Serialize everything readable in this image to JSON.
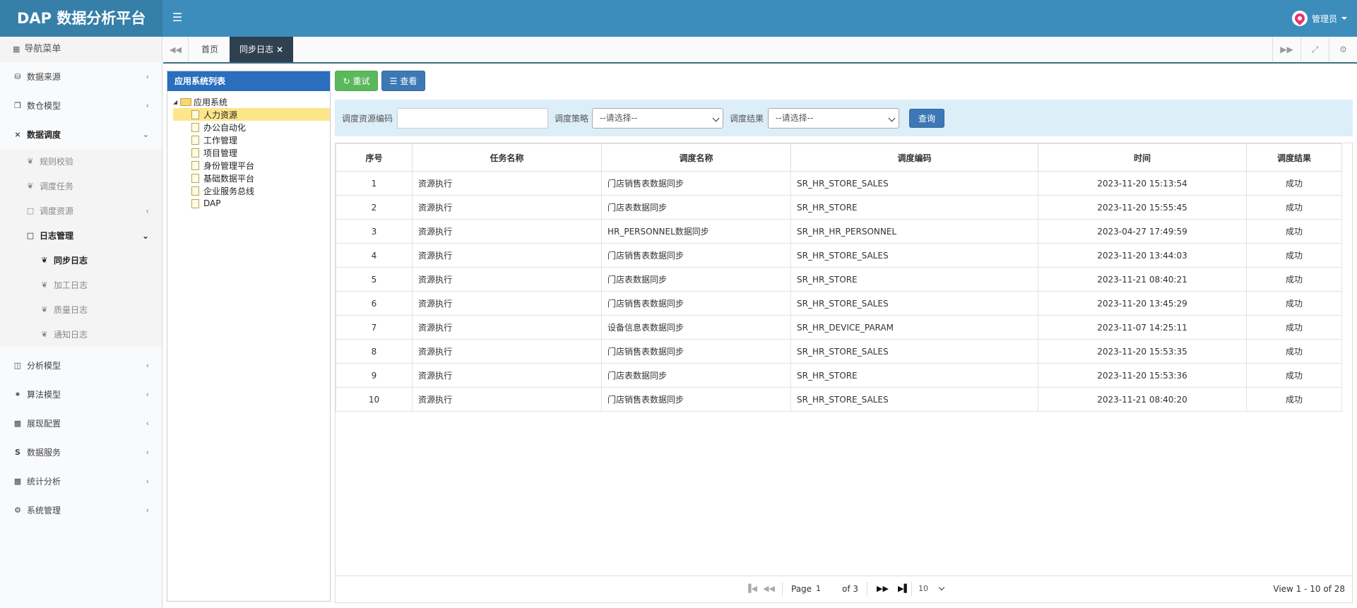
{
  "app": {
    "title": "DAP 数据分析平台"
  },
  "header": {
    "menu_icon": "hamburger-icon",
    "user_name": "管理员"
  },
  "sidebar": {
    "nav_header": "导航菜单",
    "items": [
      {
        "label": "数据来源",
        "icon": "database-icon"
      },
      {
        "label": "数仓模型",
        "icon": "cubes-icon"
      },
      {
        "label": "数据调度",
        "icon": "shuffle-icon",
        "expanded": true,
        "children": [
          {
            "label": "规则校验"
          },
          {
            "label": "调度任务"
          },
          {
            "label": "调度资源"
          },
          {
            "label": "日志管理",
            "expanded": true,
            "children": [
              {
                "label": "同步日志",
                "active": true
              },
              {
                "label": "加工日志"
              },
              {
                "label": "质量日志"
              },
              {
                "label": "通知日志"
              }
            ]
          }
        ]
      },
      {
        "label": "分析模型",
        "icon": "sitemap-icon"
      },
      {
        "label": "算法模型",
        "icon": "spinner-icon"
      },
      {
        "label": "展现配置",
        "icon": "film-icon"
      },
      {
        "label": "数据服务",
        "icon": "dollar-icon"
      },
      {
        "label": "统计分析",
        "icon": "bar-chart-icon"
      },
      {
        "label": "系统管理",
        "icon": "gear-icon"
      }
    ]
  },
  "tabs": [
    {
      "label": "首页"
    },
    {
      "label": "同步日志",
      "active": true
    }
  ],
  "tree": {
    "title": "应用系统列表",
    "root": "应用系统",
    "children": [
      "人力资源",
      "办公自动化",
      "工作管理",
      "项目管理",
      "身份管理平台",
      "基础数据平台",
      "企业服务总线",
      "DAP"
    ],
    "selected": "人力资源"
  },
  "toolbar": {
    "retry_label": "重试",
    "view_label": "查看"
  },
  "search": {
    "code_label": "调度资源编码",
    "code_value": "",
    "strategy_label": "调度策略",
    "strategy_value": "--请选择--",
    "result_label": "调度结果",
    "result_value": "--请选择--",
    "query_label": "查询"
  },
  "grid": {
    "columns": [
      "序号",
      "任务名称",
      "调度名称",
      "调度编码",
      "时间",
      "调度结果"
    ],
    "rows": [
      [
        "1",
        "资源执行",
        "门店销售表数据同步",
        "SR_HR_STORE_SALES",
        "2023-11-20 15:13:54",
        "成功"
      ],
      [
        "2",
        "资源执行",
        "门店表数据同步",
        "SR_HR_STORE",
        "2023-11-20 15:55:45",
        "成功"
      ],
      [
        "3",
        "资源执行",
        "HR_PERSONNEL数据同步",
        "SR_HR_HR_PERSONNEL",
        "2023-04-27 17:49:59",
        "成功"
      ],
      [
        "4",
        "资源执行",
        "门店销售表数据同步",
        "SR_HR_STORE_SALES",
        "2023-11-20 13:44:03",
        "成功"
      ],
      [
        "5",
        "资源执行",
        "门店表数据同步",
        "SR_HR_STORE",
        "2023-11-21 08:40:21",
        "成功"
      ],
      [
        "6",
        "资源执行",
        "门店销售表数据同步",
        "SR_HR_STORE_SALES",
        "2023-11-20 13:45:29",
        "成功"
      ],
      [
        "7",
        "资源执行",
        "设备信息表数据同步",
        "SR_HR_DEVICE_PARAM",
        "2023-11-07 14:25:11",
        "成功"
      ],
      [
        "8",
        "资源执行",
        "门店销售表数据同步",
        "SR_HR_STORE_SALES",
        "2023-11-20 15:53:35",
        "成功"
      ],
      [
        "9",
        "资源执行",
        "门店表数据同步",
        "SR_HR_STORE",
        "2023-11-20 15:53:36",
        "成功"
      ],
      [
        "10",
        "资源执行",
        "门店销售表数据同步",
        "SR_HR_STORE_SALES",
        "2023-11-21 08:40:20",
        "成功"
      ]
    ]
  },
  "pager": {
    "page_label": "Page",
    "page_value": "1",
    "of_label": "of 3",
    "page_size": "10",
    "records": "View 1 - 10 of 28"
  }
}
